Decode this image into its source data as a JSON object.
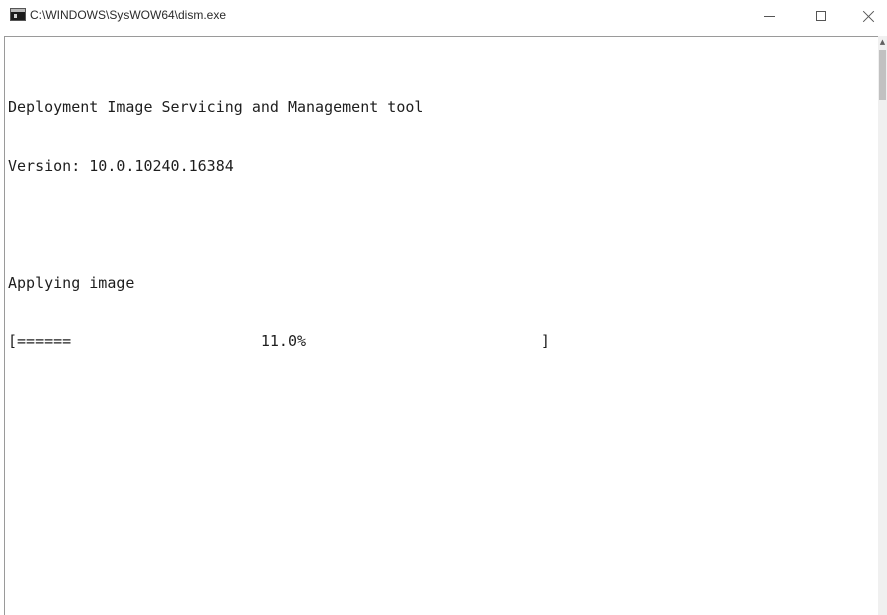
{
  "window": {
    "title": "C:\\WINDOWS\\SysWOW64\\dism.exe",
    "icon": "console-icon",
    "controls": {
      "minimize_icon": "minimize-icon",
      "maximize_icon": "maximize-icon",
      "close_icon": "close-icon"
    }
  },
  "console": {
    "lines": [
      "Deployment Image Servicing and Management tool",
      "Version: 10.0.10240.16384",
      "",
      "Applying image",
      "[======                     11.0%                          ]"
    ],
    "progress": {
      "label": "Applying image",
      "percent": 11.0
    },
    "colors": {
      "background": "#ffffff",
      "text": "#1e1e1e"
    }
  }
}
